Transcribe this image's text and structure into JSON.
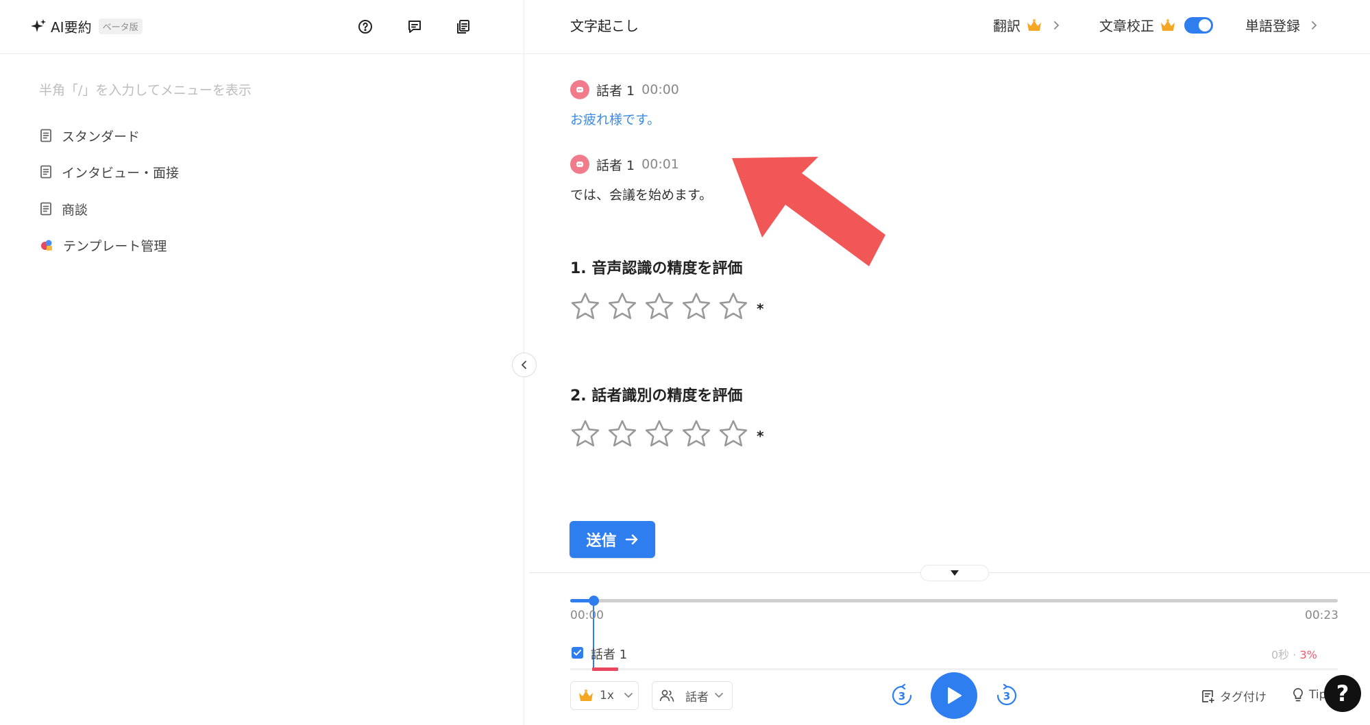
{
  "left": {
    "title": "AI要約",
    "beta_badge": "ベータ版",
    "placeholder": "半角「/」を入力してメニューを表示",
    "templates": [
      {
        "label": "スタンダード",
        "icon": "document-icon"
      },
      {
        "label": "インタビュー・面接",
        "icon": "document-icon"
      },
      {
        "label": "商談",
        "icon": "document-icon"
      },
      {
        "label": "テンプレート管理",
        "icon": "template-manage-icon"
      }
    ]
  },
  "right_header": {
    "title": "文字起こし",
    "translate": "翻訳",
    "proofread": "文章校正",
    "proofread_enabled": true,
    "dictionary": "単語登録"
  },
  "transcript": [
    {
      "speaker": "話者 1",
      "time": "00:00",
      "text": "お疲れ様です。",
      "active": true
    },
    {
      "speaker": "話者 1",
      "time": "00:01",
      "text": "では、会議を始めます。",
      "active": false
    }
  ],
  "rating": {
    "questions": [
      {
        "title": "1. 音声認識の精度を評価",
        "stars": 0,
        "max": 5,
        "required": "*"
      },
      {
        "title": "2. 話者識別の精度を評価",
        "stars": 0,
        "max": 5,
        "required": "*"
      }
    ],
    "submit": "送信"
  },
  "player": {
    "current": "00:00",
    "total": "00:23",
    "progress": 0.03,
    "speaker_label": "話者 1",
    "speaker_checked": true,
    "speaker_seconds": "0秒",
    "speaker_separator": "·",
    "speaker_percent": "3%",
    "speed": "1x",
    "speaker_filter": "話者",
    "skip_back_seconds": "3",
    "skip_forward_seconds": "3",
    "tag": "タグ付け",
    "tips": "Tips"
  },
  "colors": {
    "accent": "#2f7ef0",
    "pink": "#f05a6e",
    "arrow": "#f25757"
  }
}
